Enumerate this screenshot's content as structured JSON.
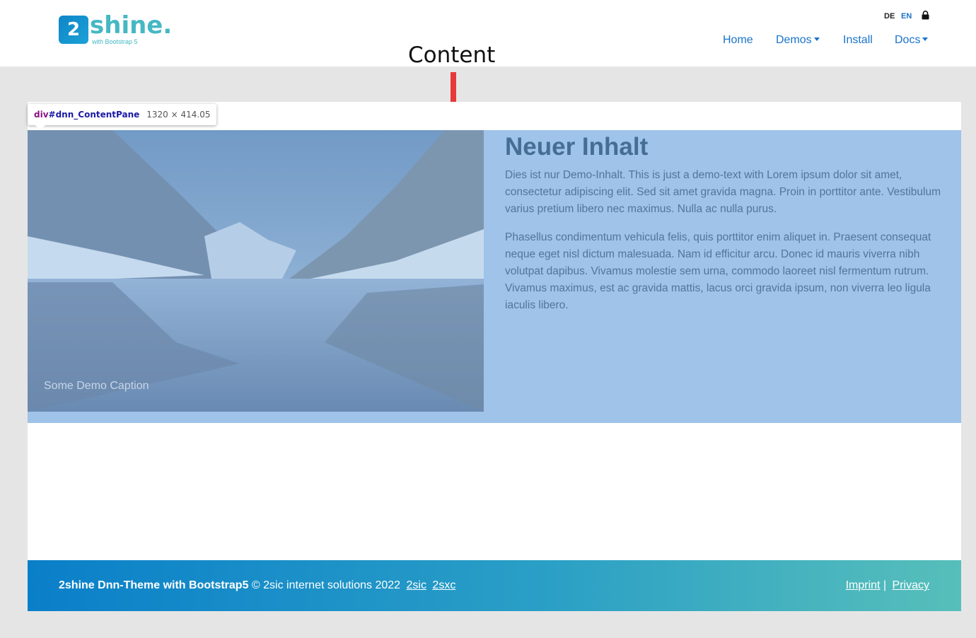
{
  "header": {
    "logo": {
      "mark": "2",
      "word": "shine.",
      "sub": "with Bootstrap 5"
    },
    "languages": [
      "DE",
      "EN"
    ],
    "active_language": "EN",
    "nav": [
      {
        "label": "Home",
        "dropdown": false
      },
      {
        "label": "Demos",
        "dropdown": true
      },
      {
        "label": "Install",
        "dropdown": false
      },
      {
        "label": "Docs",
        "dropdown": true
      }
    ]
  },
  "annotation": {
    "label": "Content"
  },
  "devtools_tooltip": {
    "tag": "div",
    "id": "#dnn_ContentPane",
    "size": "1320 × 414.05"
  },
  "content": {
    "image_caption": "Some Demo Caption",
    "title": "Neuer Inhalt",
    "paragraphs": [
      "Dies ist nur Demo-Inhalt. This is just a demo-text with Lorem ipsum dolor sit amet, consectetur adipiscing elit. Sed sit amet gravida magna. Proin in porttitor ante. Vestibulum varius pretium libero nec maximus. Nulla ac nulla purus.",
      "Phasellus condimentum vehicula felis, quis porttitor enim aliquet in. Praesent consequat neque eget nisl dictum malesuada. Nam id efficitur arcu. Donec id mauris viverra nibh volutpat dapibus. Vivamus molestie sem urna, commodo laoreet nisl fermentum rutrum. Vivamus maximus, est ac gravida mattis, lacus orci gravida ipsum, non viverra leo ligula iaculis libero."
    ]
  },
  "footer": {
    "brand": "2shine Dnn-Theme with Bootstrap5",
    "copyright": "© 2sic internet solutions 2022",
    "links_left": [
      "2sic",
      "2sxc"
    ],
    "links_right": [
      "Imprint",
      "Privacy"
    ],
    "separator": "|"
  },
  "colors": {
    "accent": "#1a73c8",
    "highlight_overlay": "#9fc3e9",
    "footer_start": "#0a7fc9",
    "footer_end": "#57bfba"
  }
}
